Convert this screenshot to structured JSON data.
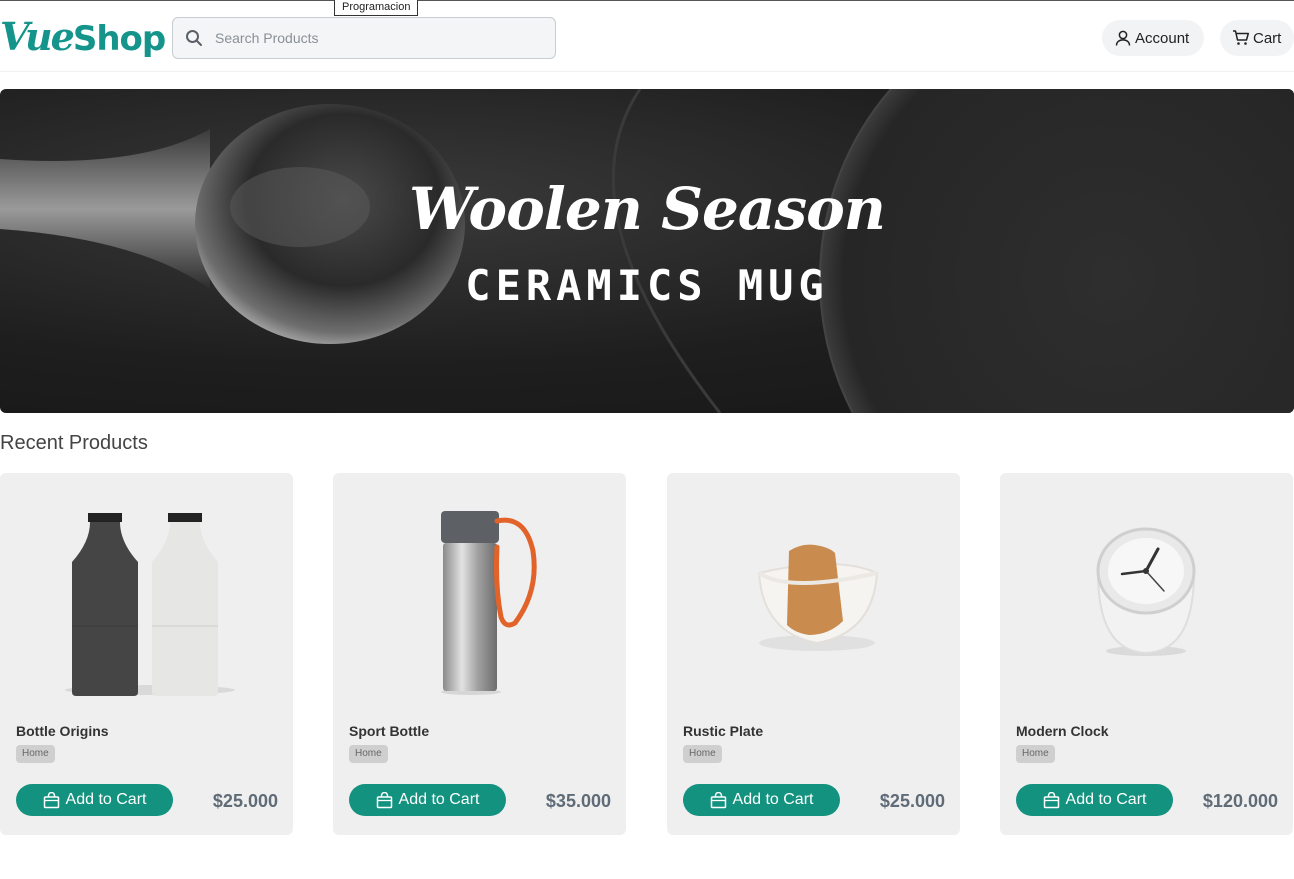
{
  "brand": {
    "part1": "Vue",
    "part2": "Shop",
    "color": "#14948a"
  },
  "search": {
    "placeholder": "Search Products",
    "icon": "search-icon"
  },
  "tooltip": "Programacion",
  "nav": {
    "account_label": "Account",
    "cart_label": "Cart",
    "account_icon": "user-icon",
    "cart_icon": "cart-icon"
  },
  "hero": {
    "title": "Woolen Season",
    "subtitle": "CERAMICS MUG"
  },
  "section": {
    "title": "Recent Products"
  },
  "accent_color": "#13937f",
  "products": [
    {
      "name": "Bottle Origins",
      "category": "Home",
      "button": "Add to Cart",
      "price": "$25.000",
      "image": "grinder-bottles"
    },
    {
      "name": "Sport Bottle",
      "category": "Home",
      "button": "Add to Cart",
      "price": "$35.000",
      "image": "thermos-bottle"
    },
    {
      "name": "Rustic Plate",
      "category": "Home",
      "button": "Add to Cart",
      "price": "$25.000",
      "image": "cork-plate"
    },
    {
      "name": "Modern Clock",
      "category": "Home",
      "button": "Add to Cart",
      "price": "$120.000",
      "image": "desk-clock"
    }
  ]
}
